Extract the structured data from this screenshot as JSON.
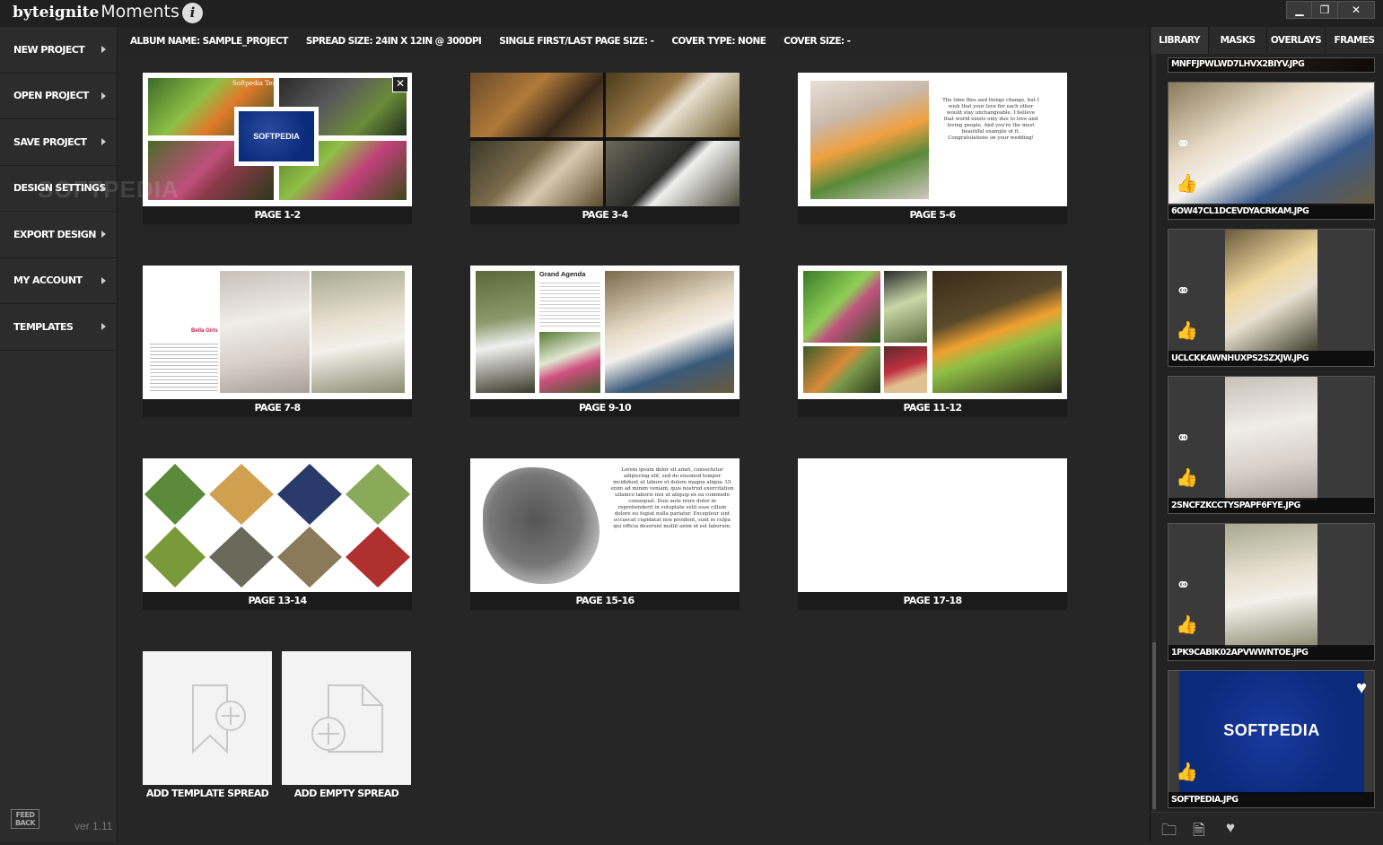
{
  "app": {
    "logo_brand": "byteignite",
    "logo_product": "Moments",
    "version": "ver 1.11",
    "feedback": "FEED BACK"
  },
  "window_controls": {
    "minimize": "▁",
    "restore": "❐",
    "close": "✕"
  },
  "sidebar": {
    "items": [
      {
        "label": "NEW PROJECT"
      },
      {
        "label": "OPEN PROJECT"
      },
      {
        "label": "SAVE PROJECT"
      },
      {
        "label": "DESIGN SETTINGS"
      },
      {
        "label": "EXPORT DESIGN"
      },
      {
        "label": "MY ACCOUNT"
      },
      {
        "label": "TEMPLATES"
      }
    ]
  },
  "infobar": {
    "album": "ALBUM NAME: SAMPLE_PROJECT",
    "spread": "SPREAD SIZE: 24IN X 12IN @ 300DPI",
    "single": "SINGLE FIRST/LAST PAGE SIZE: -",
    "cover_type": "COVER TYPE: NONE",
    "cover_size": "COVER SIZE: -"
  },
  "spreads": [
    {
      "label": "PAGE 1-2",
      "caption": "Softpedia Test",
      "badge": "SOFTPEDIA"
    },
    {
      "label": "PAGE 3-4"
    },
    {
      "label": "PAGE 5-6"
    },
    {
      "label": "PAGE 7-8",
      "caption": "Bella Girls"
    },
    {
      "label": "PAGE 9-10",
      "caption": "Grand Agenda"
    },
    {
      "label": "PAGE 11-12"
    },
    {
      "label": "PAGE 13-14"
    },
    {
      "label": "PAGE 15-16",
      "text": "Lorem ipsum dolor sit amet, consectetur adipiscing elit, sed do eiusmod tempor incididunt ut labore et dolore magna aliqua. Ut enim ad minim veniam, quis nostrud exercitation ullamco laboris nisi ut aliquip ex ea commodo consequat. Duis aute irure dolor in reprehenderit in voluptate velit esse cillum dolore eu fugiat nulla pariatur. Excepteur sint occaecat cupidatat non proident, sunt in culpa qui officia deserunt mollit anim id est laborum."
    },
    {
      "label": "PAGE 17-18"
    }
  ],
  "spread56_text": "The time flies and things change, but I wish that your love for each other would stay unchangeable. I believe that world exists only due to love and loving people. And you're the most beautiful example of it. Congratulations on your wedding!",
  "add_cards": {
    "template": "ADD TEMPLATE SPREAD",
    "empty": "ADD EMPTY SPREAD"
  },
  "right_panel": {
    "tabs": [
      "LIBRARY",
      "MASKS",
      "OVERLAYS",
      "FRAMES"
    ],
    "items": [
      {
        "name": "MNFFJPWLWD7LHVX2BIYV.JPG"
      },
      {
        "name": "6OW47CL1DCEVDYACRKAM.JPG"
      },
      {
        "name": "UCLCKKAWNHUXPS2SZXJW.JPG"
      },
      {
        "name": "2SNCFZKCCTYSPAPF6FYE.JPG"
      },
      {
        "name": "1PK9CABIK02APVWWNTOE.JPG"
      },
      {
        "name": "SOFTPEDIA.JPG",
        "logo": "SOFTPEDIA"
      }
    ]
  },
  "watermark": "SOFTPEDIA",
  "colors": {
    "accent_blue": "#0a2a7a",
    "bg": "#262626",
    "panel": "#222222"
  }
}
